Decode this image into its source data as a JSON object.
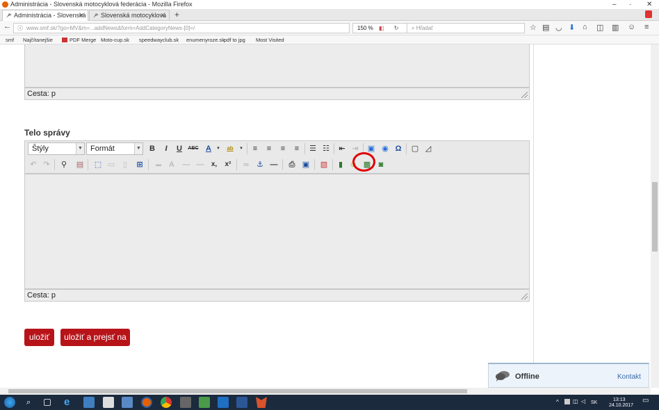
{
  "window": {
    "title": "Administrácia - Slovenská motocyklová federácia - Mozilla Firefox"
  },
  "tabs": [
    {
      "label": "Administrácia - Slovenská m",
      "active": true
    },
    {
      "label": "Slovenská motocyklová fed",
      "active": false
    }
  ],
  "nav": {
    "url": "www.smf.sk/?go=MV&m=...addNews&form=AddCategoryNews-[0]=/",
    "zoom": "150 %",
    "search_placeholder": "Hľadať"
  },
  "bookmarks": [
    "smf",
    "Najčítanejšie",
    "PDF Merge",
    "Moto-cup.sk",
    "speedwayclub.sk",
    "enumenyroze.sk",
    "pdf to jpg",
    "Most Visited"
  ],
  "editor": {
    "path_label_top": "Cesta: p",
    "body_label": "Telo správy",
    "styles_select": "Štýly",
    "format_select": "Formát",
    "path_label_bottom": "Cesta: p"
  },
  "buttons": {
    "save": "uložiť",
    "save_and_go": "uložiť a prejsť na"
  },
  "chat": {
    "status": "Offline",
    "contact": "Kontakt"
  },
  "taskbar": {
    "lang": "SK",
    "time": "13:13",
    "date": "24.10.2017"
  },
  "colors": {
    "button_red": "#b7141a",
    "highlight_red": "#e00000",
    "arrow_border": "#4a6fa5"
  }
}
